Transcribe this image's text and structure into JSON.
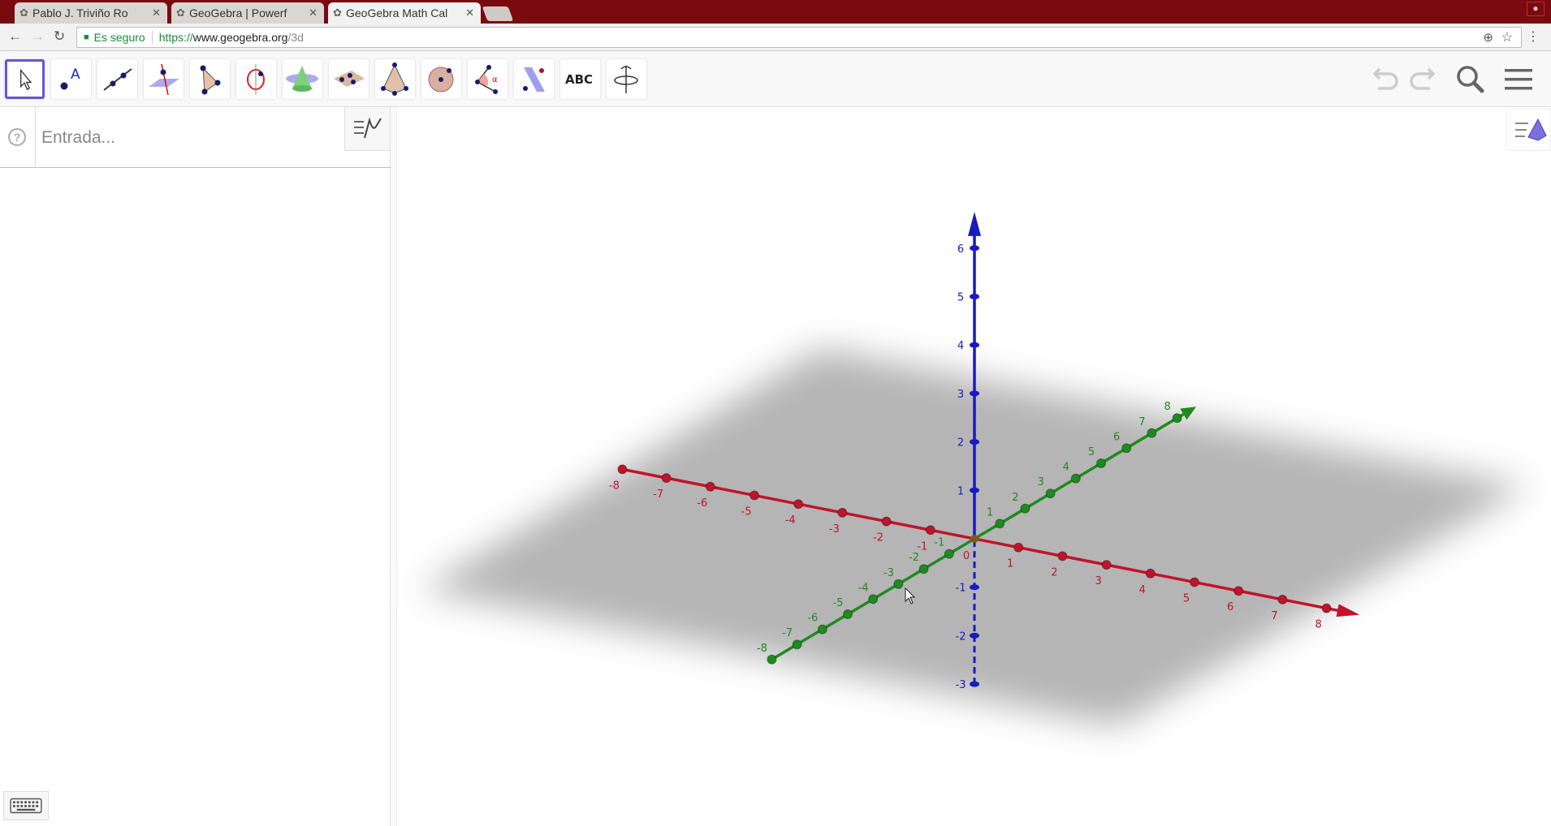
{
  "browser": {
    "tabs": [
      {
        "label": "Pablo J. Triviño Ro",
        "active": false
      },
      {
        "label": "GeoGebra | Powerf",
        "active": false
      },
      {
        "label": "GeoGebra Math Cal",
        "active": true
      }
    ],
    "security_label": "Es seguro",
    "url_protocol": "https://",
    "url_host": "www.geogebra.org",
    "url_path": "/3d"
  },
  "toolbar": {
    "tools": [
      "move",
      "point",
      "line",
      "perpendicular-line",
      "polygon",
      "circle-axis-point",
      "cone",
      "plane-three-points",
      "pyramid",
      "sphere",
      "angle",
      "reflect-about-plane",
      "text",
      "rotate-view"
    ],
    "text_tool_label": "ABC",
    "selected": "move"
  },
  "algebra": {
    "input_placeholder": "Entrada..."
  },
  "view3d": {
    "colors": {
      "x_axis": "#c0142a",
      "y_axis": "#1f8a1f",
      "z_axis": "#1a1ac0",
      "plane": "#b8b8b8"
    },
    "x_range": [
      -8,
      8
    ],
    "y_range": [
      -8,
      8
    ],
    "z_range": [
      -3,
      6
    ],
    "origin_label": "0"
  }
}
